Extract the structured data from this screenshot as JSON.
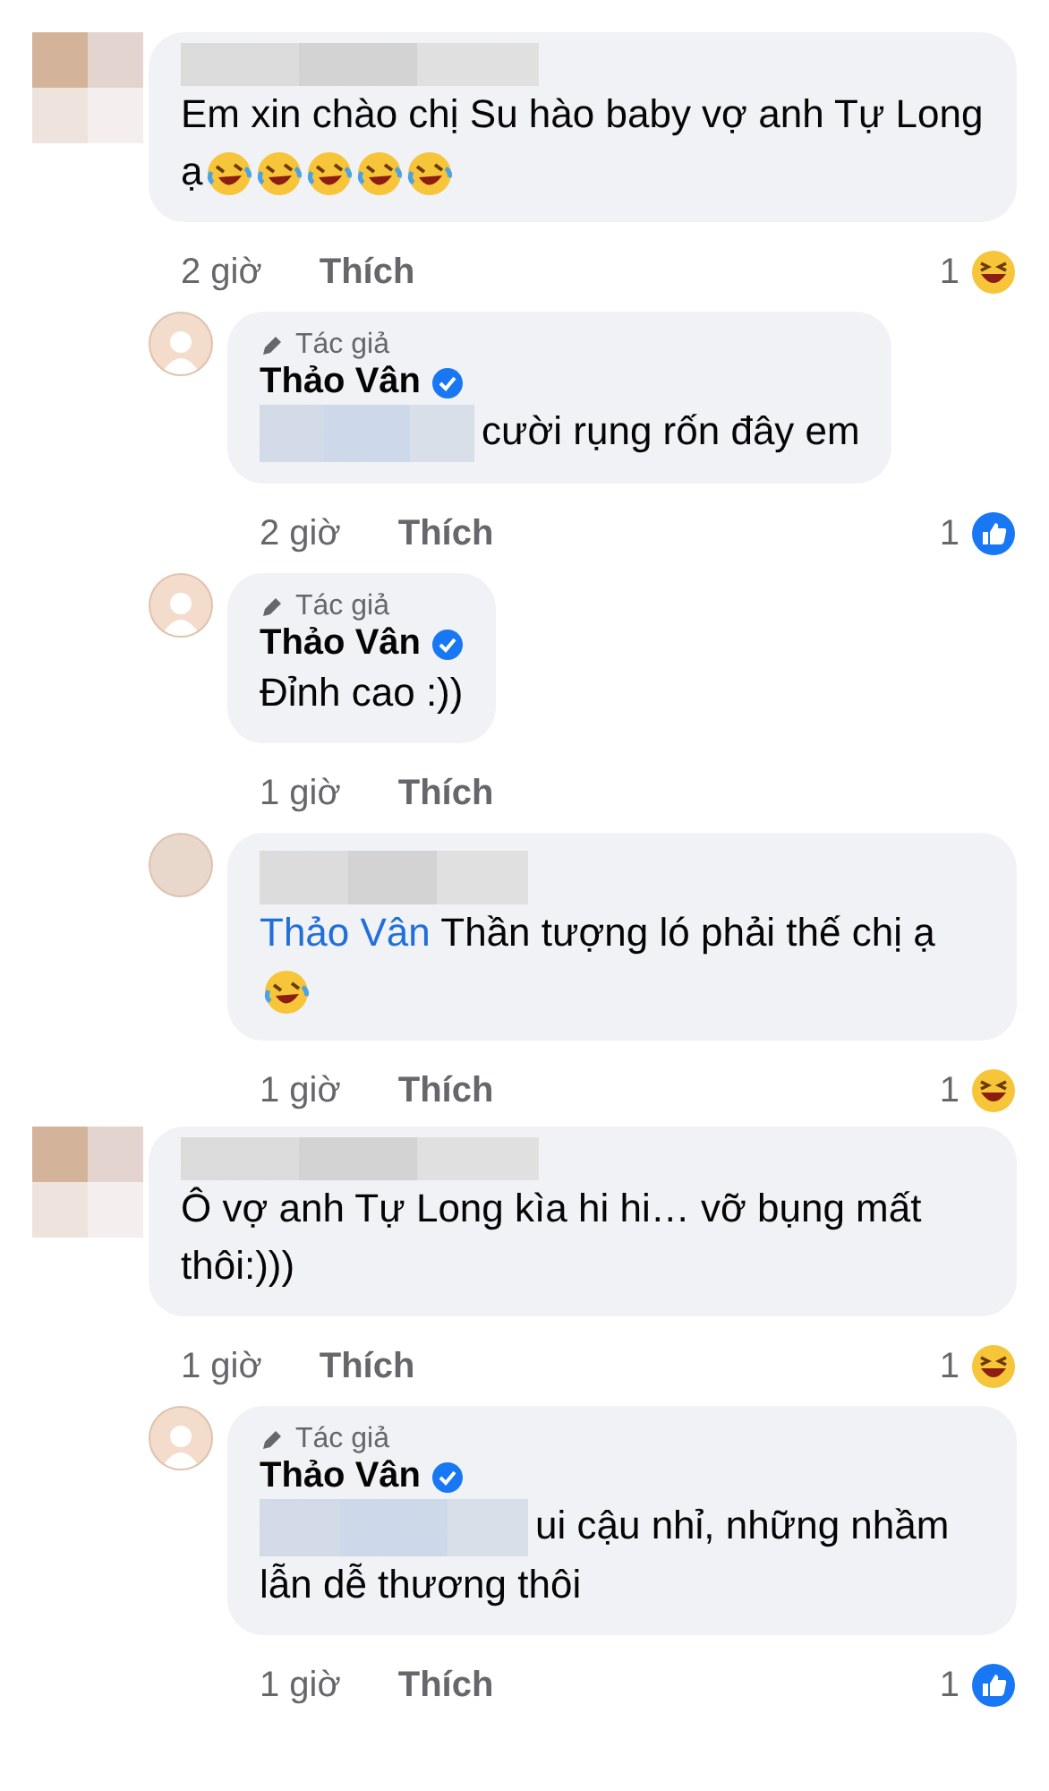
{
  "comments": [
    {
      "avatar": {
        "kind": "blurred"
      },
      "author_redacted": true,
      "text": "Em xin chào chị Su hào baby vợ anh Tự Long ạ",
      "emojis": [
        {
          "kind": "rofl"
        },
        {
          "kind": "rofl"
        },
        {
          "kind": "rofl"
        },
        {
          "kind": "rofl"
        },
        {
          "kind": "rofl"
        }
      ],
      "time": "2 giờ",
      "like_label": "Thích",
      "reaction": {
        "count": "1",
        "kind": "haha"
      },
      "replies": [
        {
          "avatar": {
            "kind": "photo"
          },
          "badge": "Tác giả",
          "author": "Thảo Vân",
          "verified": true,
          "text_redacted_prefix": true,
          "text": "cười rụng rốn đây em",
          "time": "2 giờ",
          "like_label": "Thích",
          "reaction": {
            "count": "1",
            "kind": "like"
          }
        },
        {
          "avatar": {
            "kind": "photo"
          },
          "badge": "Tác giả",
          "author": "Thảo Vân",
          "verified": true,
          "text": "Đỉnh cao :))",
          "time": "1 giờ",
          "like_label": "Thích"
        },
        {
          "avatar": {
            "kind": "blurred"
          },
          "author_redacted": true,
          "mention": "Thảo Vân",
          "text": "Thần tượng ló phải thế chị ạ",
          "emojis": [
            {
              "kind": "rofl"
            }
          ],
          "time": "1 giờ",
          "like_label": "Thích",
          "reaction": {
            "count": "1",
            "kind": "haha"
          }
        }
      ]
    },
    {
      "avatar": {
        "kind": "blurred"
      },
      "author_redacted": true,
      "text": "Ô vợ anh Tự Long kìa hi hi… vỡ bụng mất thôi:)))",
      "time": "1 giờ",
      "like_label": "Thích",
      "reaction": {
        "count": "1",
        "kind": "haha"
      },
      "replies": [
        {
          "avatar": {
            "kind": "photo"
          },
          "badge": "Tác giả",
          "author": "Thảo Vân",
          "verified": true,
          "text_redacted_prefix": true,
          "text": "ui cậu nhỉ, những nhầm lẫn dễ thương thôi",
          "time": "1 giờ",
          "like_label": "Thích",
          "reaction": {
            "count": "1",
            "kind": "like"
          }
        }
      ]
    }
  ]
}
